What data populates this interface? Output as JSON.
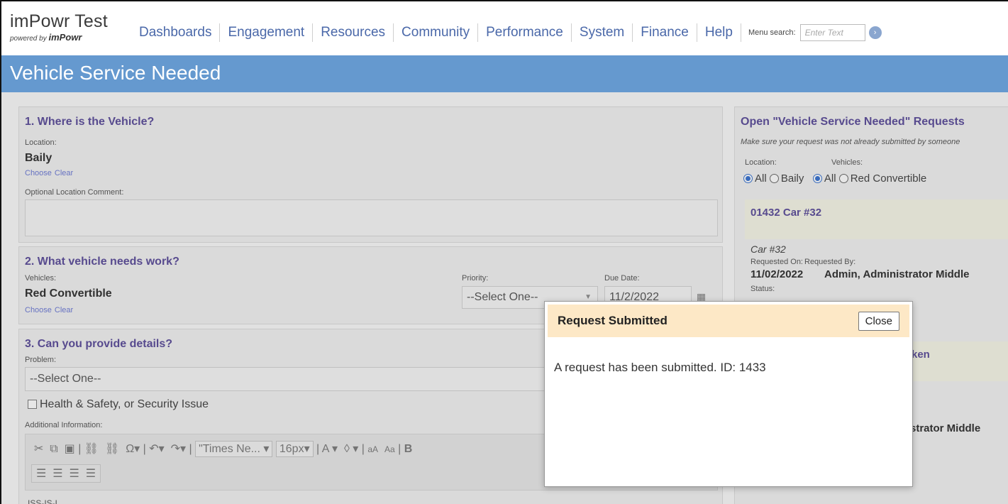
{
  "app": {
    "title": "imPowr Test",
    "powered_prefix": "powered by",
    "powered_brand": "imPowr"
  },
  "nav": {
    "items": [
      "Dashboards",
      "Engagement",
      "Resources",
      "Community",
      "Performance",
      "System",
      "Finance",
      "Help"
    ],
    "menu_search_label": "Menu search:",
    "menu_search_placeholder": "Enter Text"
  },
  "page": {
    "title": "Vehicle Service Needed"
  },
  "section1": {
    "title": "1. Where is the Vehicle?",
    "location_label": "Location:",
    "location_value": "Baily",
    "choose": "Choose",
    "clear": "Clear",
    "comment_label": "Optional Location Comment:"
  },
  "section2": {
    "title": "2. What vehicle needs work?",
    "vehicles_label": "Vehicles:",
    "vehicles_value": "Red Convertible",
    "choose": "Choose",
    "clear": "Clear",
    "priority_label": "Priority:",
    "priority_value": "--Select One--",
    "due_label": "Due Date:",
    "due_value": "11/2/2022"
  },
  "section3": {
    "title": "3. Can you provide details?",
    "problem_label": "Problem:",
    "problem_value": "--Select One--",
    "safety_label": "Health & Safety, or Security Issue",
    "additional_label": "Additional Information:",
    "font_family": "\"Times Ne...",
    "font_size": "16px",
    "editor_text": "ISS-IS-L"
  },
  "open_requests": {
    "title": "Open \"Vehicle Service Needed\" Requests",
    "subtitle": "Make sure your request was not already submitted by someone",
    "location_label": "Location:",
    "vehicles_label": "Vehicles:",
    "loc_all": "All",
    "loc_baily": "Baily",
    "veh_all": "All",
    "veh_red": "Red Convertible",
    "card1_head": "01432 Car #32",
    "card1_sub": "Car #32",
    "req_on_label": "Requested On:",
    "req_by_label": "Requested By:",
    "req_on_value": "11/02/2022",
    "req_by_value": "Admin, Administrator Middle",
    "status_label": "Status:",
    "card2_head_fragment": "ken",
    "card2_by_fragment": "strator Middle"
  },
  "modal": {
    "title": "Request Submitted",
    "close_label": "Close",
    "message": "A request has been submitted. ID: 1433"
  }
}
